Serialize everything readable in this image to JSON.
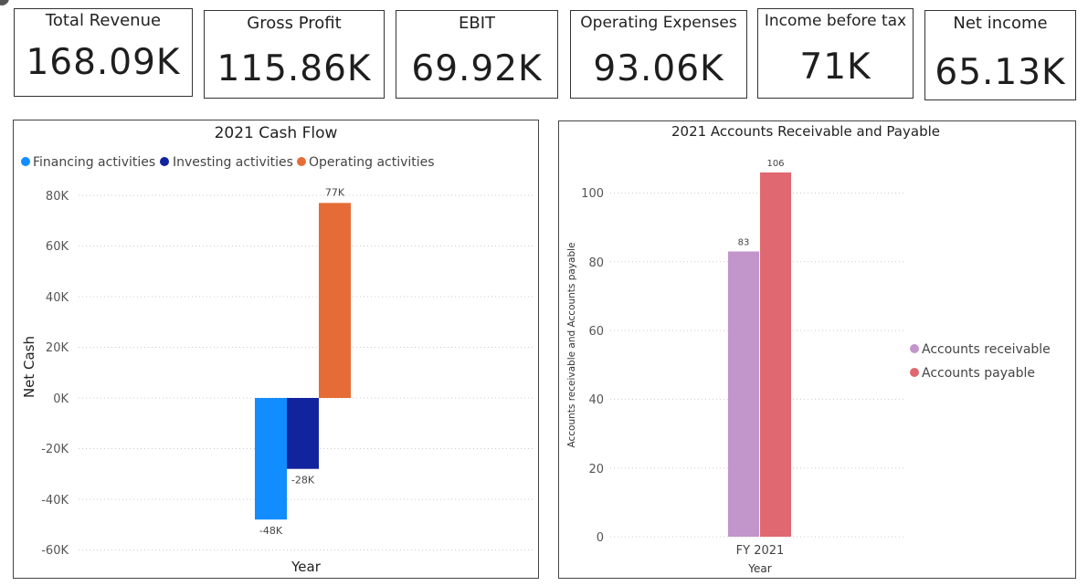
{
  "kpis": [
    {
      "title": "Total Revenue",
      "value": "168.09K"
    },
    {
      "title": "Gross Profit",
      "value": "115.86K"
    },
    {
      "title": "EBIT",
      "value": "69.92K"
    },
    {
      "title": "Operating Expenses",
      "value": "93.06K"
    },
    {
      "title": "Income before tax",
      "value": "71K"
    },
    {
      "title": "Net income",
      "value": "65.13K"
    }
  ],
  "chart_data": [
    {
      "type": "bar",
      "title": "2021 Cash Flow",
      "xlabel": "Year",
      "ylabel": "Net Cash",
      "ylim": [
        -60000,
        80000
      ],
      "yticks": [
        80000,
        60000,
        40000,
        20000,
        0,
        -20000,
        -40000,
        -60000
      ],
      "ytick_labels": [
        "80K",
        "60K",
        "40K",
        "20K",
        "0K",
        "-20K",
        "-40K",
        "-60K"
      ],
      "grid": true,
      "legend_position": "top-left",
      "series": [
        {
          "name": "Financing activities",
          "values": [
            -48000
          ],
          "label": "-48K",
          "color": "#118DFF"
        },
        {
          "name": "Investing activities",
          "values": [
            -28000
          ],
          "label": "-28K",
          "color": "#12239E"
        },
        {
          "name": "Operating activities",
          "values": [
            77000
          ],
          "label": "77K",
          "color": "#E66C37"
        }
      ]
    },
    {
      "type": "bar",
      "title": "2021 Accounts Receivable and Payable",
      "categories": [
        "FY 2021"
      ],
      "xlabel": "Year",
      "ylabel": "Accounts receivable and Accounts payable",
      "ylim": [
        0,
        110
      ],
      "yticks": [
        0,
        20,
        40,
        60,
        80,
        100
      ],
      "ytick_labels": [
        "0",
        "20",
        "40",
        "60",
        "80",
        "100"
      ],
      "grid": true,
      "legend_position": "right",
      "series": [
        {
          "name": "Accounts receivable",
          "values": [
            83
          ],
          "label": "83",
          "color": "#C295CB"
        },
        {
          "name": "Accounts payable",
          "values": [
            106
          ],
          "label": "106",
          "color": "#E06870"
        }
      ]
    }
  ]
}
